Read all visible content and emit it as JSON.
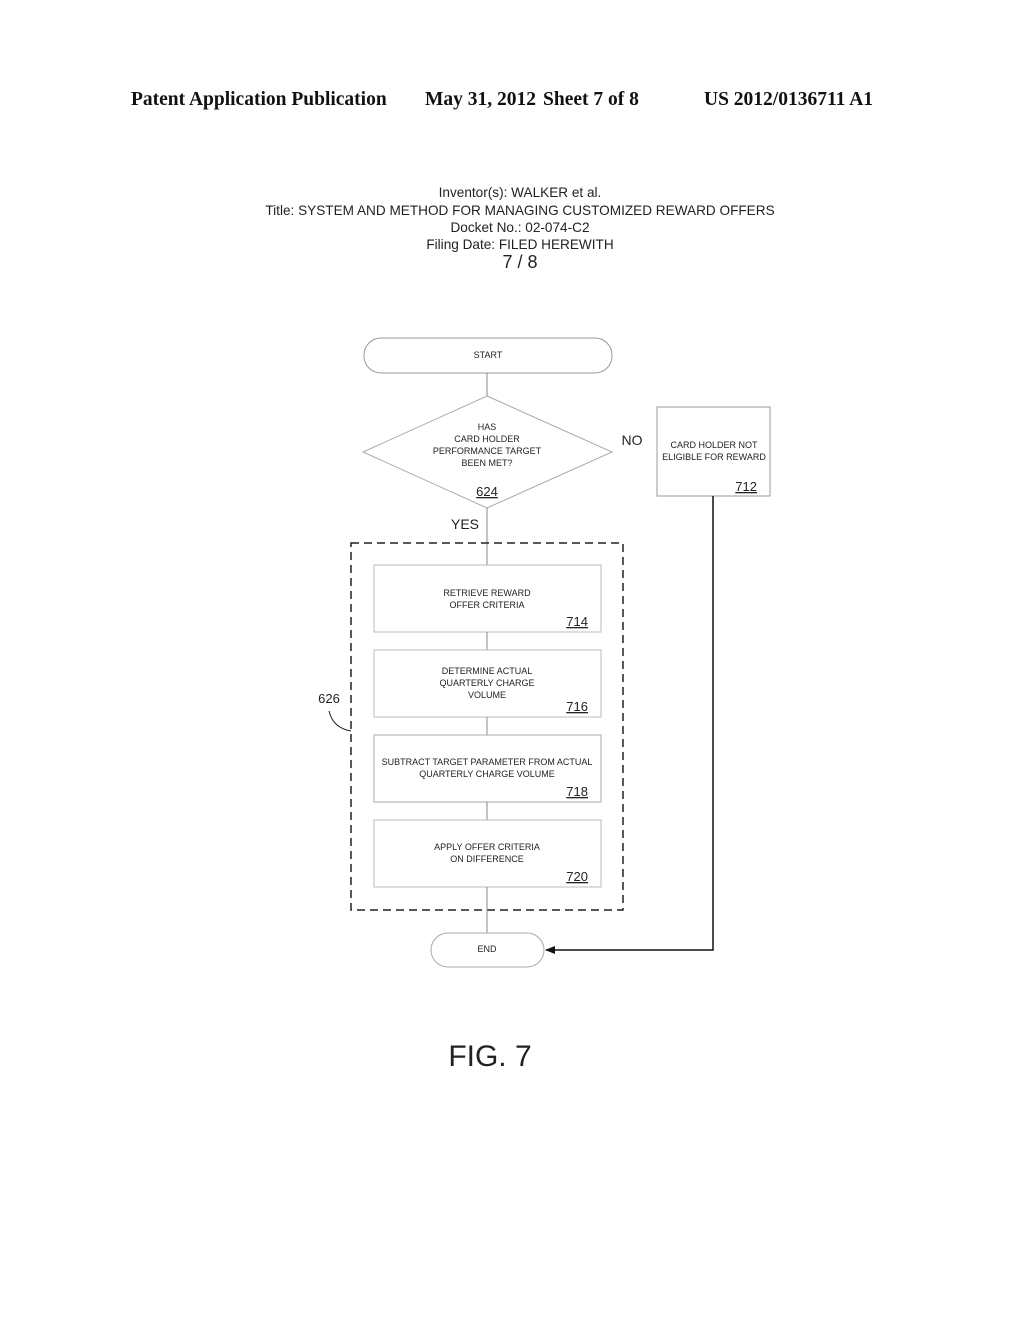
{
  "header": {
    "publication_type": "Patent Application Publication",
    "date": "May 31, 2012",
    "sheet": "Sheet 7 of 8",
    "patent_number": "US 2012/0136711 A1"
  },
  "meta": {
    "inventors": "Inventor(s): WALKER et al.",
    "title": "Title: SYSTEM AND METHOD FOR MANAGING CUSTOMIZED REWARD OFFERS",
    "docket": "Docket No.: 02-074-C2",
    "filing_date": "Filing Date: FILED HEREWITH",
    "page": "7 / 8"
  },
  "flowchart": {
    "start": "START",
    "end": "END",
    "decision": {
      "lines": [
        "HAS",
        "CARD HOLDER",
        "PERFORMANCE TARGET",
        "BEEN MET?"
      ],
      "ref": "624",
      "yes_label": "YES",
      "no_label": "NO"
    },
    "not_eligible": {
      "lines": [
        "CARD HOLDER NOT",
        "ELIGIBLE FOR REWARD"
      ],
      "ref": "712"
    },
    "group_ref": "626",
    "steps": [
      {
        "lines": [
          "RETRIEVE REWARD",
          "OFFER CRITERIA"
        ],
        "ref": "714"
      },
      {
        "lines": [
          "DETERMINE ACTUAL",
          "QUARTERLY CHARGE",
          "VOLUME"
        ],
        "ref": "716"
      },
      {
        "lines": [
          "SUBTRACT TARGET PARAMETER FROM ACTUAL",
          "QUARTERLY CHARGE VOLUME"
        ],
        "ref": "718"
      },
      {
        "lines": [
          "APPLY OFFER CRITERIA",
          "ON DIFFERENCE"
        ],
        "ref": "720"
      }
    ]
  },
  "figure_label": "FIG. 7"
}
